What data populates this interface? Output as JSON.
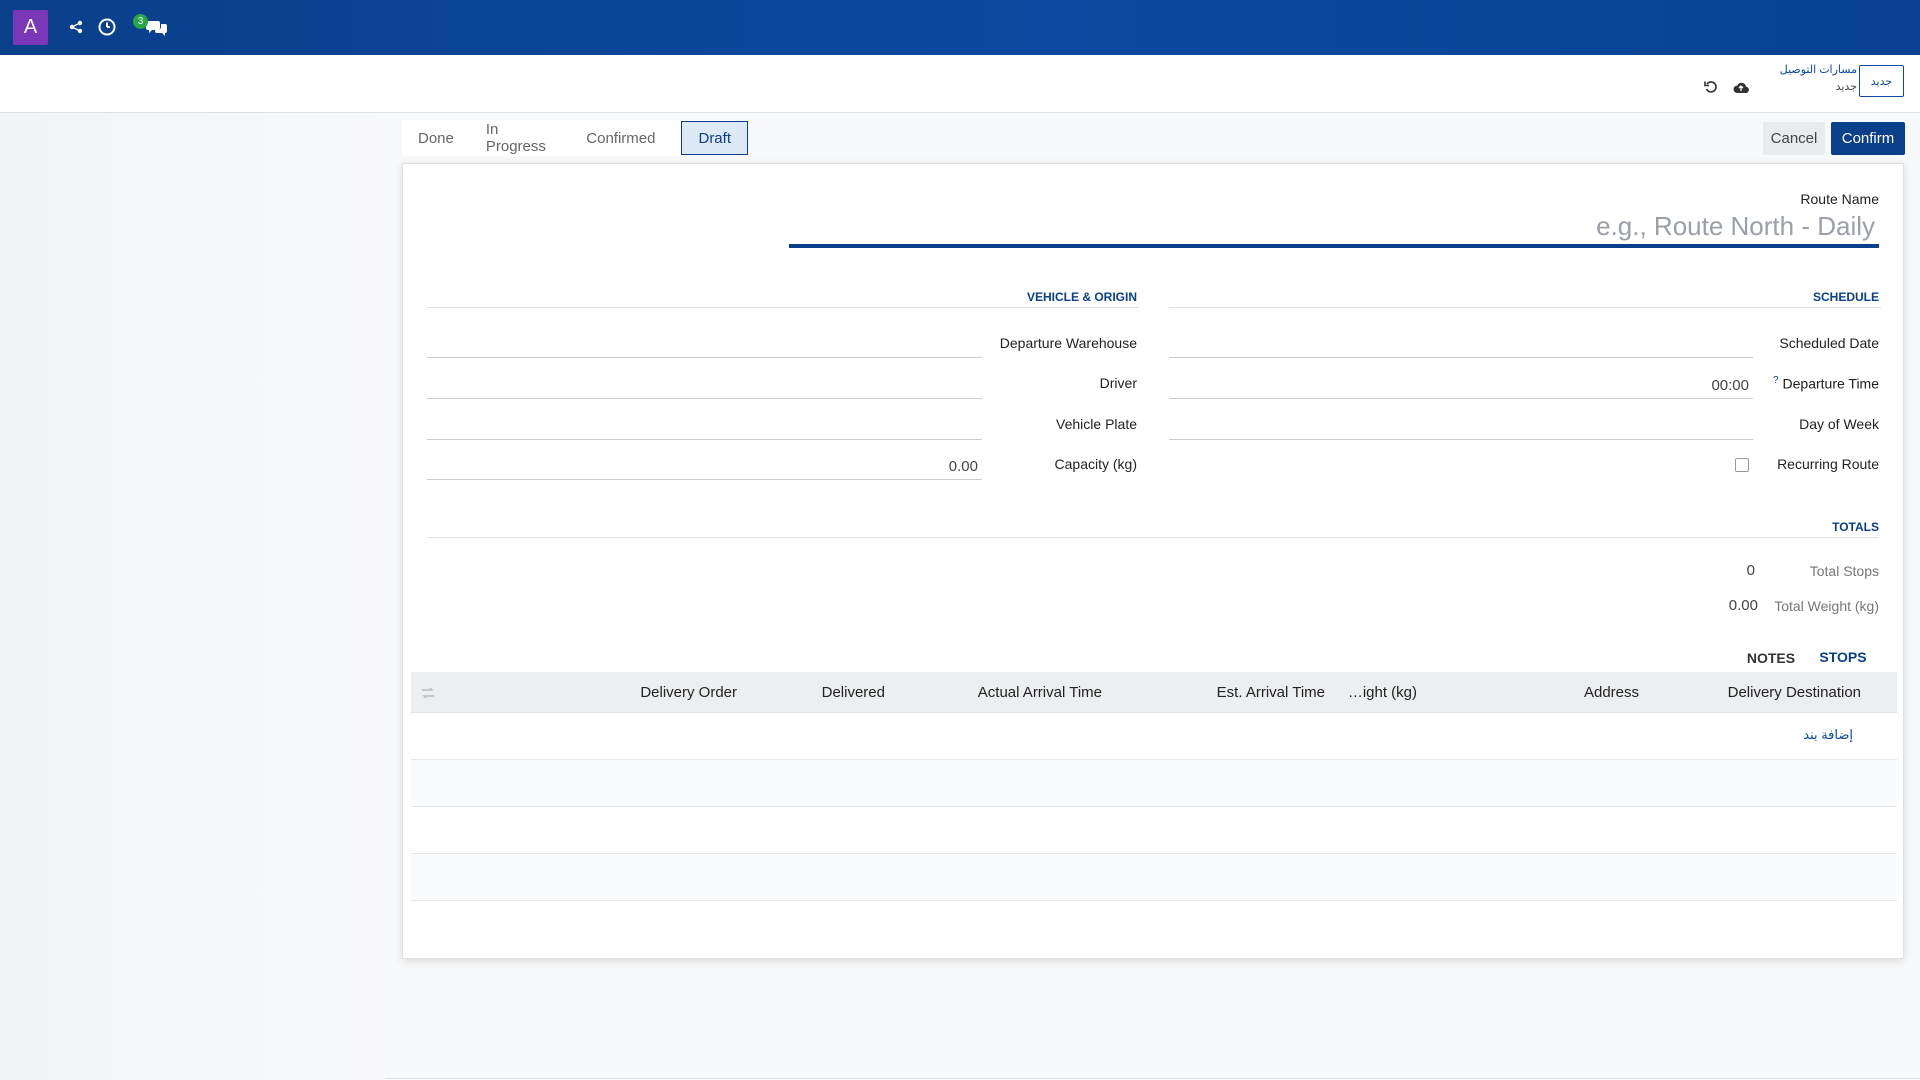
{
  "navbar": {
    "avatar_letter": "A",
    "icons": [
      "share-icon",
      "clock-icon",
      "chat-icon"
    ],
    "chat_badge": "3",
    "bg_color": "#0b4aa0"
  },
  "control_panel": {
    "new_button": "جديد",
    "breadcrumb_parent": "مسارات التوصيل",
    "breadcrumb_current": "جديد",
    "icons": [
      "discard-icon",
      "save-cloud-icon"
    ]
  },
  "statusbar": {
    "states": [
      "Done",
      "In Progress",
      "Confirmed",
      "Draft"
    ],
    "active": "Draft",
    "cancel_label": "Cancel",
    "confirm_label": "Confirm"
  },
  "form": {
    "route_name_label": "Route Name",
    "route_name_placeholder": "e.g., Route North - Daily",
    "vehicle_group": {
      "title": "VEHICLE & ORIGIN",
      "departure_warehouse_label": "Departure Warehouse",
      "departure_warehouse_value": "",
      "driver_label": "Driver",
      "driver_value": "",
      "vehicle_plate_label": "Vehicle Plate",
      "vehicle_plate_value": "",
      "capacity_label": "Capacity (kg)",
      "capacity_value": "0.00"
    },
    "schedule_group": {
      "title": "SCHEDULE",
      "scheduled_date_label": "Scheduled Date",
      "scheduled_date_value": "",
      "departure_time_label": "Departure Time",
      "departure_time_help": "?",
      "departure_time_value": "00:00",
      "day_of_week_label": "Day of Week",
      "day_of_week_value": "",
      "recurring_label": "Recurring Route",
      "recurring_checked": false
    },
    "totals": {
      "title": "TOTALS",
      "total_stops_label": "Total Stops",
      "total_stops_value": "0",
      "total_weight_label": "Total Weight (kg)",
      "total_weight_value": "0.00"
    },
    "tabs": [
      "STOPS",
      "NOTES"
    ],
    "active_tab": "STOPS",
    "stops_table": {
      "columns": [
        "Delivery Destination",
        "Address",
        "…ight (kg)",
        "Est. Arrival Time",
        "Actual Arrival Time",
        "Delivered",
        "Delivery Order"
      ],
      "add_line": "إضافة بند",
      "rows": []
    }
  }
}
